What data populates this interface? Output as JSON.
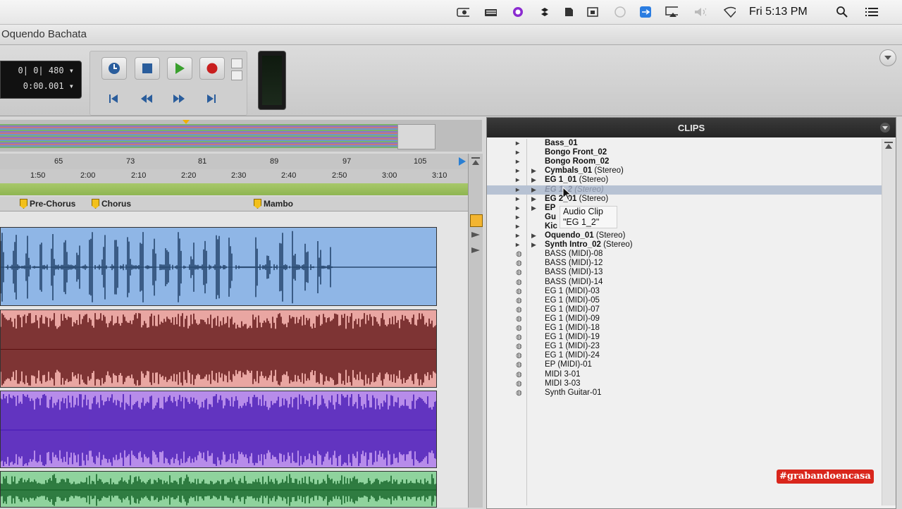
{
  "menubar": {
    "clock": "Fri 5:13 PM",
    "icons": [
      "camera-icon",
      "keyboard-icon",
      "sync-icon",
      "dropbox-icon",
      "evernote-icon",
      "screen-capture-icon",
      "disabled-icon",
      "teamviewer-icon",
      "airplay-icon",
      "volume-icon",
      "wifi-icon",
      "search-icon",
      "list-icon"
    ]
  },
  "window": {
    "title": "Oquendo Bachata"
  },
  "counter": {
    "main": "0| 0| 480",
    "sub": "0:00.001"
  },
  "rulers": {
    "bars": [
      "65",
      "73",
      "81",
      "89",
      "97",
      "105"
    ],
    "times": [
      "1:50",
      "2:00",
      "2:10",
      "2:20",
      "2:30",
      "2:40",
      "2:50",
      "3:00",
      "3:10"
    ]
  },
  "markers": [
    "Pre-Chorus",
    "Chorus",
    "Mambo"
  ],
  "clips": {
    "title": "CLIPS",
    "tooltip": {
      "line1": "Audio Clip",
      "line2": "\"EG 1_2\""
    },
    "items": [
      {
        "name": "Bass_01",
        "suffix": "",
        "type": "audio",
        "bold": true,
        "expand": false
      },
      {
        "name": "Bongo Front_02",
        "suffix": "",
        "type": "audio",
        "bold": true,
        "expand": false
      },
      {
        "name": "Bongo Room_02",
        "suffix": "",
        "type": "audio",
        "bold": true,
        "expand": false
      },
      {
        "name": "Cymbals_01",
        "suffix": " (Stereo)",
        "type": "audio",
        "bold": true,
        "expand": true
      },
      {
        "name": "EG 1_01",
        "suffix": " (Stereo)",
        "type": "audio",
        "bold": true,
        "expand": true
      },
      {
        "name": "EG 1_2",
        "suffix": " (Stereo)",
        "type": "audio",
        "bold": true,
        "expand": true,
        "selected": true
      },
      {
        "name": "EG 2_01",
        "suffix": " (Stereo)",
        "type": "audio",
        "bold": true,
        "expand": true
      },
      {
        "name": "EP",
        "suffix": "",
        "type": "audio",
        "bold": true,
        "expand": true
      },
      {
        "name": "Gu",
        "suffix": "",
        "type": "audio",
        "bold": true,
        "expand": false
      },
      {
        "name": "Kic",
        "suffix": "",
        "type": "audio",
        "bold": true,
        "expand": false
      },
      {
        "name": "Oquendo_01",
        "suffix": " (Stereo)",
        "type": "audio",
        "bold": true,
        "expand": true
      },
      {
        "name": "Synth Intro_02",
        "suffix": " (Stereo)",
        "type": "audio",
        "bold": true,
        "expand": true
      },
      {
        "name": "BASS (MIDI)-08",
        "suffix": "",
        "type": "midi",
        "bold": false,
        "expand": false
      },
      {
        "name": "BASS (MIDI)-12",
        "suffix": "",
        "type": "midi",
        "bold": false,
        "expand": false
      },
      {
        "name": "BASS (MIDI)-13",
        "suffix": "",
        "type": "midi",
        "bold": false,
        "expand": false
      },
      {
        "name": "BASS (MIDI)-14",
        "suffix": "",
        "type": "midi",
        "bold": false,
        "expand": false
      },
      {
        "name": "EG 1 (MIDI)-03",
        "suffix": "",
        "type": "midi",
        "bold": false,
        "expand": false
      },
      {
        "name": "EG 1 (MIDI)-05",
        "suffix": "",
        "type": "midi",
        "bold": false,
        "expand": false
      },
      {
        "name": "EG 1 (MIDI)-07",
        "suffix": "",
        "type": "midi",
        "bold": false,
        "expand": false
      },
      {
        "name": "EG 1 (MIDI)-09",
        "suffix": "",
        "type": "midi",
        "bold": false,
        "expand": false
      },
      {
        "name": "EG 1 (MIDI)-18",
        "suffix": "",
        "type": "midi",
        "bold": false,
        "expand": false
      },
      {
        "name": "EG 1 (MIDI)-19",
        "suffix": "",
        "type": "midi",
        "bold": false,
        "expand": false
      },
      {
        "name": "EG 1 (MIDI)-23",
        "suffix": "",
        "type": "midi",
        "bold": false,
        "expand": false
      },
      {
        "name": "EG 1 (MIDI)-24",
        "suffix": "",
        "type": "midi",
        "bold": false,
        "expand": false
      },
      {
        "name": "EP (MIDI)-01",
        "suffix": "",
        "type": "midi",
        "bold": false,
        "expand": false
      },
      {
        "name": "MIDI 3-01",
        "suffix": "",
        "type": "midi",
        "bold": false,
        "expand": false
      },
      {
        "name": "MIDI 3-03",
        "suffix": "",
        "type": "midi",
        "bold": false,
        "expand": false
      },
      {
        "name": "Synth Guitar-01",
        "suffix": "",
        "type": "midi",
        "bold": false,
        "expand": false
      }
    ]
  },
  "watermark": "#grabandoencasa",
  "colors": {
    "track_blue": "#8fb6e6",
    "wave_blue": "#1f3f66",
    "track_red": "#e9a6a2",
    "wave_red": "#5b0f0f",
    "track_purple": "#b78cea",
    "wave_purple": "#4516b3",
    "track_green": "#8fd39d",
    "wave_green": "#0f5e22",
    "marker_yellow": "#f2c01b",
    "watermark_bg": "#d9261c"
  }
}
